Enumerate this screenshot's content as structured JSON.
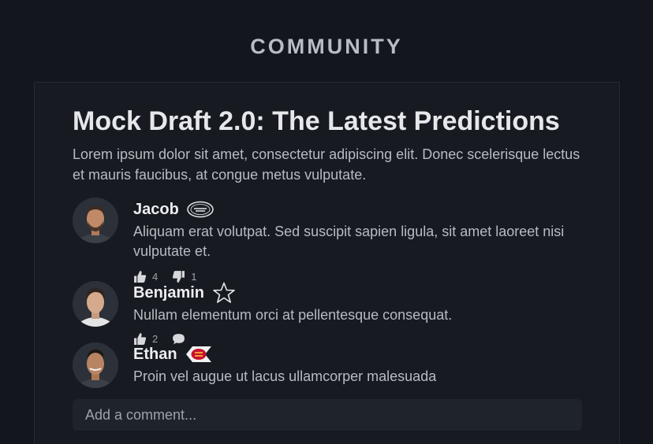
{
  "header": {
    "title": "COMMUNITY"
  },
  "post": {
    "title": "Mock Draft 2.0: The Latest Predictions",
    "body": "Lorem ipsum dolor sit amet, consectetur adipiscing elit. Donec scelerisque lectus et mauris faucibus, at congue metus vulputate."
  },
  "comments": [
    {
      "name": "Jacob",
      "team_icon": "jets-logo-icon",
      "text": "Aliquam erat volutpat. Sed suscipit sapien ligula, sit amet laoreet nisi vulputate et.",
      "likes": "4",
      "dislikes": "1"
    },
    {
      "name": "Benjamin",
      "team_icon": "cowboys-star-icon",
      "text": "Nullam elementum orci at pellentesque consequat.",
      "likes": "2"
    },
    {
      "name": "Ethan",
      "team_icon": "chiefs-logo-icon",
      "text": "Proin vel augue ut lacus ullamcorper malesuada"
    }
  ],
  "add_comment": {
    "placeholder": "Add a comment..."
  },
  "colors": {
    "background": "#13161d",
    "panel": "#171a21",
    "input": "#1f232b",
    "chiefs_red": "#c8102e",
    "jets_green": "#1f5a3a"
  }
}
